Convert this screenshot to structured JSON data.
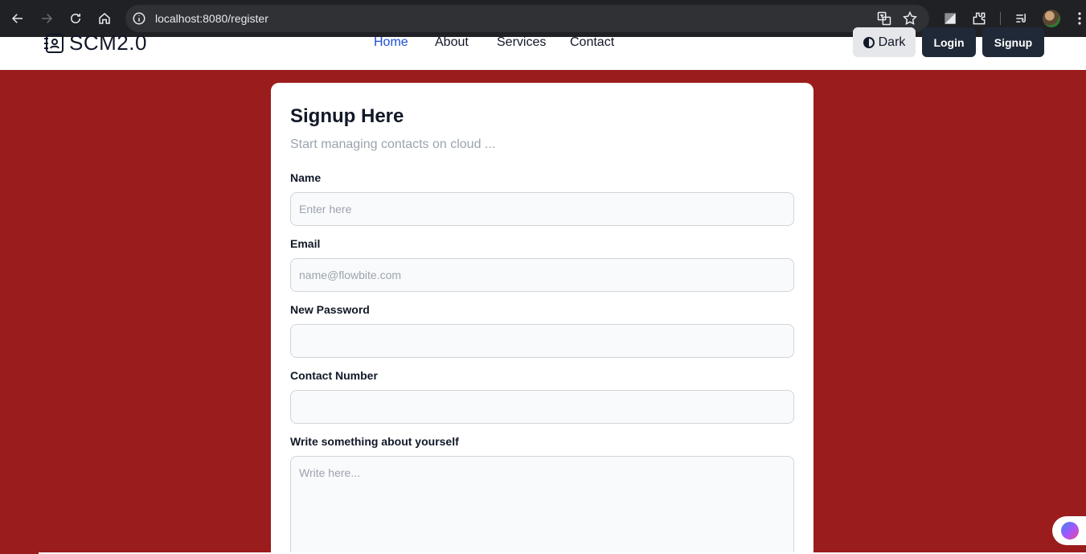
{
  "browser": {
    "url": "localhost:8080/register"
  },
  "navbar": {
    "brand": "SCM2.0",
    "links": [
      "Home",
      "About",
      "Services",
      "Contact"
    ],
    "dark_label": "Dark",
    "login_label": "Login",
    "signup_label": "Signup"
  },
  "form": {
    "title": "Signup Here",
    "subtitle": "Start managing contacts on cloud ...",
    "name_label": "Name",
    "name_placeholder": "Enter here",
    "email_label": "Email",
    "email_placeholder": "name@flowbite.com",
    "password_label": "New Password",
    "contact_label": "Contact Number",
    "about_label": "Write something about yourself",
    "about_placeholder": "Write here..."
  },
  "colors": {
    "page_background": "#9b1c1c",
    "active_link": "#1d4ed8",
    "button_dark": "#1f2937"
  }
}
